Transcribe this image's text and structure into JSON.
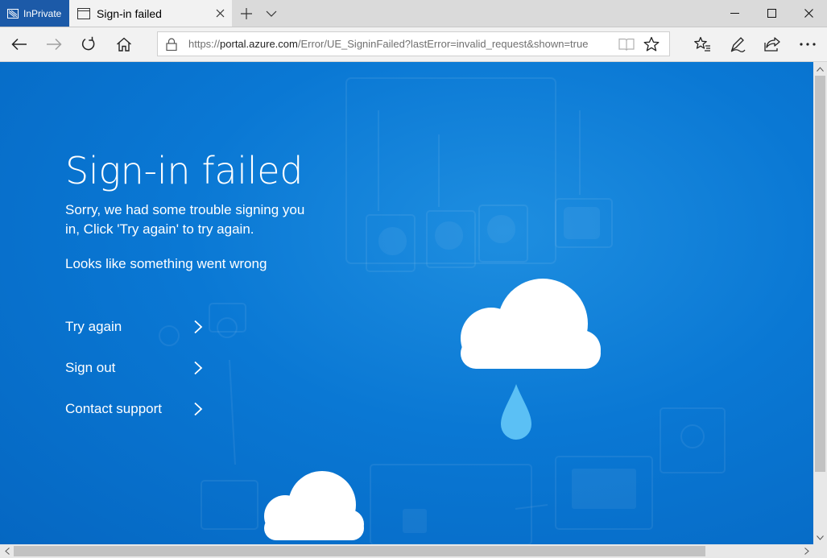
{
  "browser": {
    "inprivate_label": "InPrivate",
    "tab": {
      "title": "Sign-in failed"
    },
    "address": {
      "scheme": "https://",
      "domain": "portal.azure.com",
      "path": "/Error/UE_SigninFailed?lastError=invalid_request&shown=true"
    },
    "icons": {
      "back": "back-arrow-icon",
      "forward": "forward-arrow-icon",
      "refresh": "refresh-icon",
      "home": "home-icon",
      "favorites": "favorites-hub-icon",
      "notes": "web-note-icon",
      "share": "share-icon",
      "more": "more-icon"
    }
  },
  "page": {
    "title": "Sign-in failed",
    "description": "Sorry, we had some trouble signing you in, Click 'Try again' to try again.",
    "subtext": "Looks like something went wrong",
    "actions": [
      {
        "label": "Try again"
      },
      {
        "label": "Sign out"
      },
      {
        "label": "Contact support"
      }
    ],
    "colors": {
      "background": "#0a78d4",
      "text": "#ffffff",
      "raindrop": "#5bc0f5",
      "inprivate": "#1c5aa8"
    }
  },
  "scroll": {
    "vertical_visible_fraction": 0.87,
    "horizontal_visible_fraction": 0.88
  }
}
